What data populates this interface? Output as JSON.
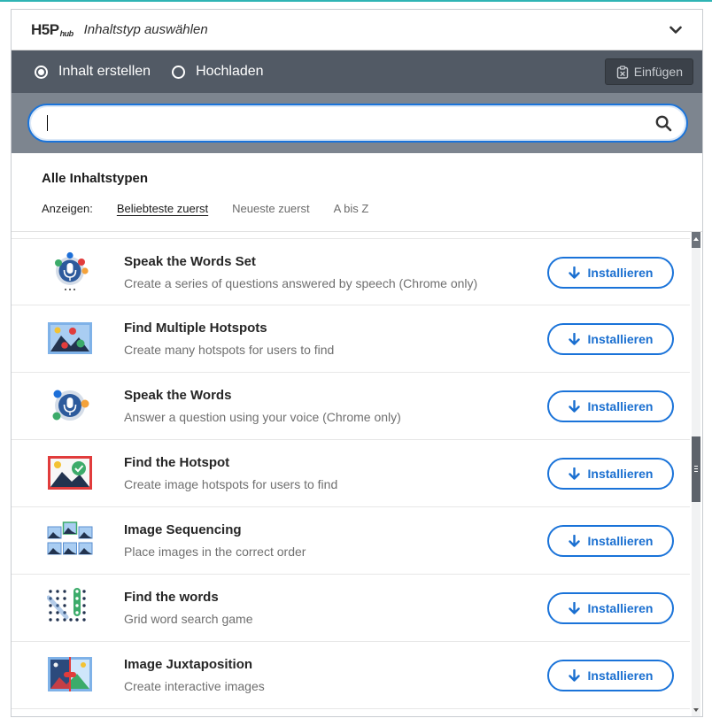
{
  "colors": {
    "accent": "#1a73d9",
    "tabs_bg": "#525a65",
    "search_bg": "#7d858f",
    "top_line": "#2fb4b4"
  },
  "header": {
    "logo_main": "H5P",
    "logo_sub": "hub",
    "title": "Inhaltstyp auswählen",
    "toggle_icon": "chevron-down-icon"
  },
  "tabs": [
    {
      "label": "Inhalt erstellen",
      "selected": true
    },
    {
      "label": "Hochladen",
      "selected": false
    }
  ],
  "paste_button": {
    "label": "Einfügen",
    "icon": "clipboard-icon"
  },
  "search": {
    "value": "",
    "placeholder": "",
    "icon": "search-icon"
  },
  "filter": {
    "title": "Alle Inhaltstypen",
    "show_label": "Anzeigen:",
    "options": [
      {
        "label": "Beliebteste zuerst",
        "active": true
      },
      {
        "label": "Neueste zuerst",
        "active": false
      },
      {
        "label": "A bis Z",
        "active": false
      }
    ]
  },
  "install_label": "Installieren",
  "content_types": [
    {
      "title": "Speak the Words Set",
      "description": "Create a series of questions answered by speech (Chrome only)",
      "icon": "microphone-set-icon"
    },
    {
      "title": "Find Multiple Hotspots",
      "description": "Create many hotspots for users to find",
      "icon": "multiple-hotspots-icon"
    },
    {
      "title": "Speak the Words",
      "description": "Answer a question using your voice (Chrome only)",
      "icon": "microphone-icon"
    },
    {
      "title": "Find the Hotspot",
      "description": "Create image hotspots for users to find",
      "icon": "hotspot-icon"
    },
    {
      "title": "Image Sequencing",
      "description": "Place images in the correct order",
      "icon": "image-sequencing-icon"
    },
    {
      "title": "Find the words",
      "description": "Grid word search game",
      "icon": "word-grid-icon"
    },
    {
      "title": "Image Juxtaposition",
      "description": "Create interactive images",
      "icon": "image-juxtaposition-icon"
    }
  ]
}
